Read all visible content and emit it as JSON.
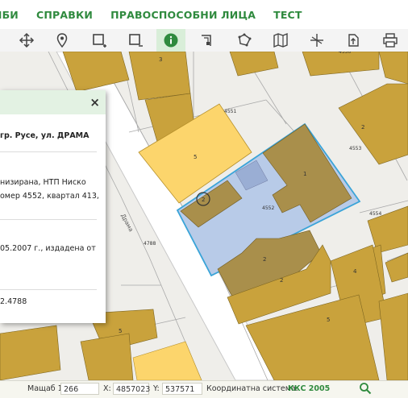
{
  "menu": {
    "items": [
      "ЛБИ",
      "СПРАВКИ",
      "ПРАВОСПОСОБНИ ЛИЦА",
      "ТЕСТ"
    ]
  },
  "toolbar": {
    "tools": [
      "pan-icon",
      "location-pin-icon",
      "select-rectangle-icon",
      "deselect-rectangle-icon",
      "info-icon",
      "measure-distance-icon",
      "measure-area-icon",
      "map-layers-icon",
      "split-icon",
      "export-icon",
      "print-icon"
    ],
    "active_tool": "info-icon"
  },
  "info_panel": {
    "close_label": "×",
    "address": "гр. Русе, ул. ДРАМА",
    "line1": "низирана,  НТП  Ниско",
    "line2": "омер 4552, квартал 413,",
    "line3": "05.2007  г.,  издадена  от",
    "line4": "2.4788"
  },
  "map": {
    "parcel_numbers": [
      "4551",
      "4553",
      "4552",
      "4554",
      "4788",
      "4550"
    ],
    "building_labels": [
      "3",
      "5",
      "1",
      "2",
      "2",
      "2",
      "2",
      "5",
      "5",
      "4"
    ],
    "street_label": "Драма",
    "colors": {
      "background": "#efeeea",
      "building": "#c9a23c",
      "yellow_building": "#fcd56c",
      "selected_parcel": "#b8cbe8",
      "selected_outline": "#3aa4d8",
      "street": "#ffffff"
    }
  },
  "status": {
    "scale_label": "Мащаб 1:",
    "scale_value": "266",
    "x_label": "X:",
    "x_value": "4857023",
    "y_label": "Y:",
    "y_value": "537571",
    "crs_label": "Координатна система:",
    "crs_value": "ККС 2005"
  }
}
